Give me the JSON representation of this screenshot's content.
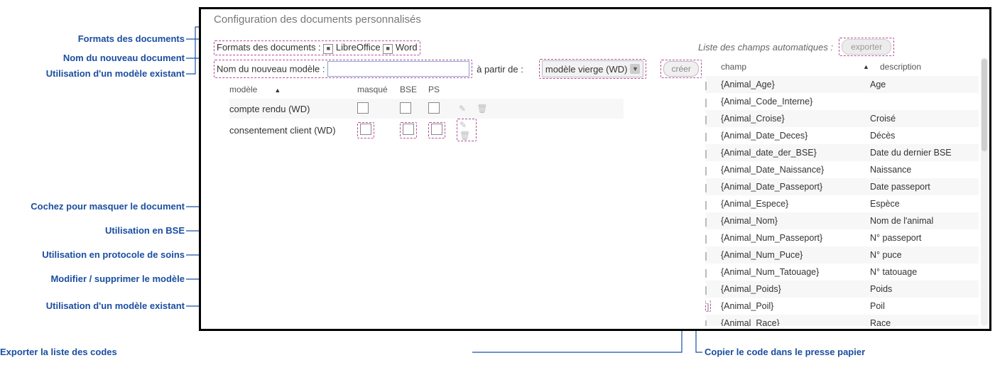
{
  "panel_title": "Configuration des documents personnalisés",
  "formats": {
    "label": "Formats des documents :",
    "opt1": "LibreOffice",
    "opt2": "Word"
  },
  "new_model": {
    "label": "Nom du nouveau modèle :",
    "apartir": "à partir de :",
    "combo": "modèle vierge (WD)",
    "create": "créer"
  },
  "models_headers": {
    "modele": "modèle",
    "masque": "masqué",
    "bse": "BSE",
    "ps": "PS"
  },
  "models": [
    {
      "name": "compte rendu (WD)"
    },
    {
      "name": "consentement client (WD)"
    }
  ],
  "fields_header": "Liste des champs automatiques :",
  "fields_export": "exporter",
  "fields_cols": {
    "champ": "champ",
    "desc": "description"
  },
  "fields": [
    {
      "c": "{Animal_Age}",
      "d": "Age"
    },
    {
      "c": "{Animal_Code_Interne}",
      "d": ""
    },
    {
      "c": "{Animal_Croise}",
      "d": "Croisé"
    },
    {
      "c": "{Animal_Date_Deces}",
      "d": "Décès"
    },
    {
      "c": "{Animal_date_der_BSE}",
      "d": "Date du dernier BSE"
    },
    {
      "c": "{Animal_Date_Naissance}",
      "d": "Naissance"
    },
    {
      "c": "{Animal_Date_Passeport}",
      "d": "Date passeport"
    },
    {
      "c": "{Animal_Espece}",
      "d": "Espèce"
    },
    {
      "c": "{Animal_Nom}",
      "d": "Nom de l'animal"
    },
    {
      "c": "{Animal_Num_Passeport}",
      "d": "N° passeport"
    },
    {
      "c": "{Animal_Num_Puce}",
      "d": "N° puce"
    },
    {
      "c": "{Animal_Num_Tatouage}",
      "d": "N° tatouage"
    },
    {
      "c": "{Animal_Poids}",
      "d": "Poids"
    },
    {
      "c": "{Animal_Poil}",
      "d": "Poil"
    },
    {
      "c": "{Animal_Race}",
      "d": "Race"
    }
  ],
  "callouts": {
    "l1": "Formats des documents",
    "l2": "Nom du nouveau document",
    "l3": "Utilisation d'un modèle existant",
    "l4": "Cochez pour masquer le document",
    "l5": "Utilisation en BSE",
    "l6": "Utilisation en protocole de soins",
    "l7": "Modifier / supprimer le modèle",
    "l8": "Utilisation d'un modèle existant",
    "b1": "Exporter la liste des codes",
    "b2": "Copier le code dans le presse papier"
  }
}
